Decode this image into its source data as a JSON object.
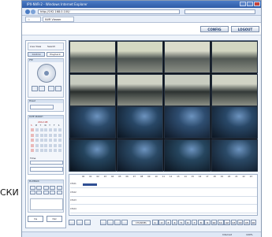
{
  "window": {
    "title": "IPX-NVR-2 - Windows Internet Explorer",
    "url": "http://192.168.0.100/",
    "tab_label": "NVR Viewer"
  },
  "header": {
    "config_label": "CONFIG",
    "logout_label": "LOGOUT"
  },
  "left_panel": {
    "view_modes": [
      "Live View",
      "Search"
    ],
    "tabs": [
      "Control",
      "Playback"
    ],
    "ptz_title": "PTZ",
    "preset_label": "Preset",
    "calendar_title": "DATE SEARCH",
    "calendar_month": "2012.08",
    "calendar_days": [
      "S",
      "M",
      "T",
      "W",
      "T",
      "F",
      "S"
    ],
    "time_label": "Time",
    "playback_title": "PLAYBACK",
    "bottom_left_label": "Ins",
    "bottom_right_label": "Del"
  },
  "timeline": {
    "hours": [
      "00",
      "01",
      "02",
      "03",
      "04",
      "05",
      "06",
      "07",
      "08",
      "09",
      "10",
      "11",
      "12",
      "13",
      "14",
      "15",
      "16",
      "17",
      "18",
      "19",
      "20",
      "21",
      "22",
      "23"
    ],
    "rows": [
      "CH-01",
      "CH-02",
      "CH-03",
      "CH-04"
    ],
    "channel_label": "CHANNEL"
  },
  "controls": {
    "channel_numbers": [
      "1",
      "2",
      "3",
      "4",
      "5",
      "6",
      "7",
      "8",
      "9",
      "10",
      "11",
      "12",
      "13",
      "14",
      "15",
      "16"
    ]
  },
  "status": {
    "left": "",
    "right": "Internet",
    "zoom": "100%"
  },
  "side_label": "СКИ"
}
